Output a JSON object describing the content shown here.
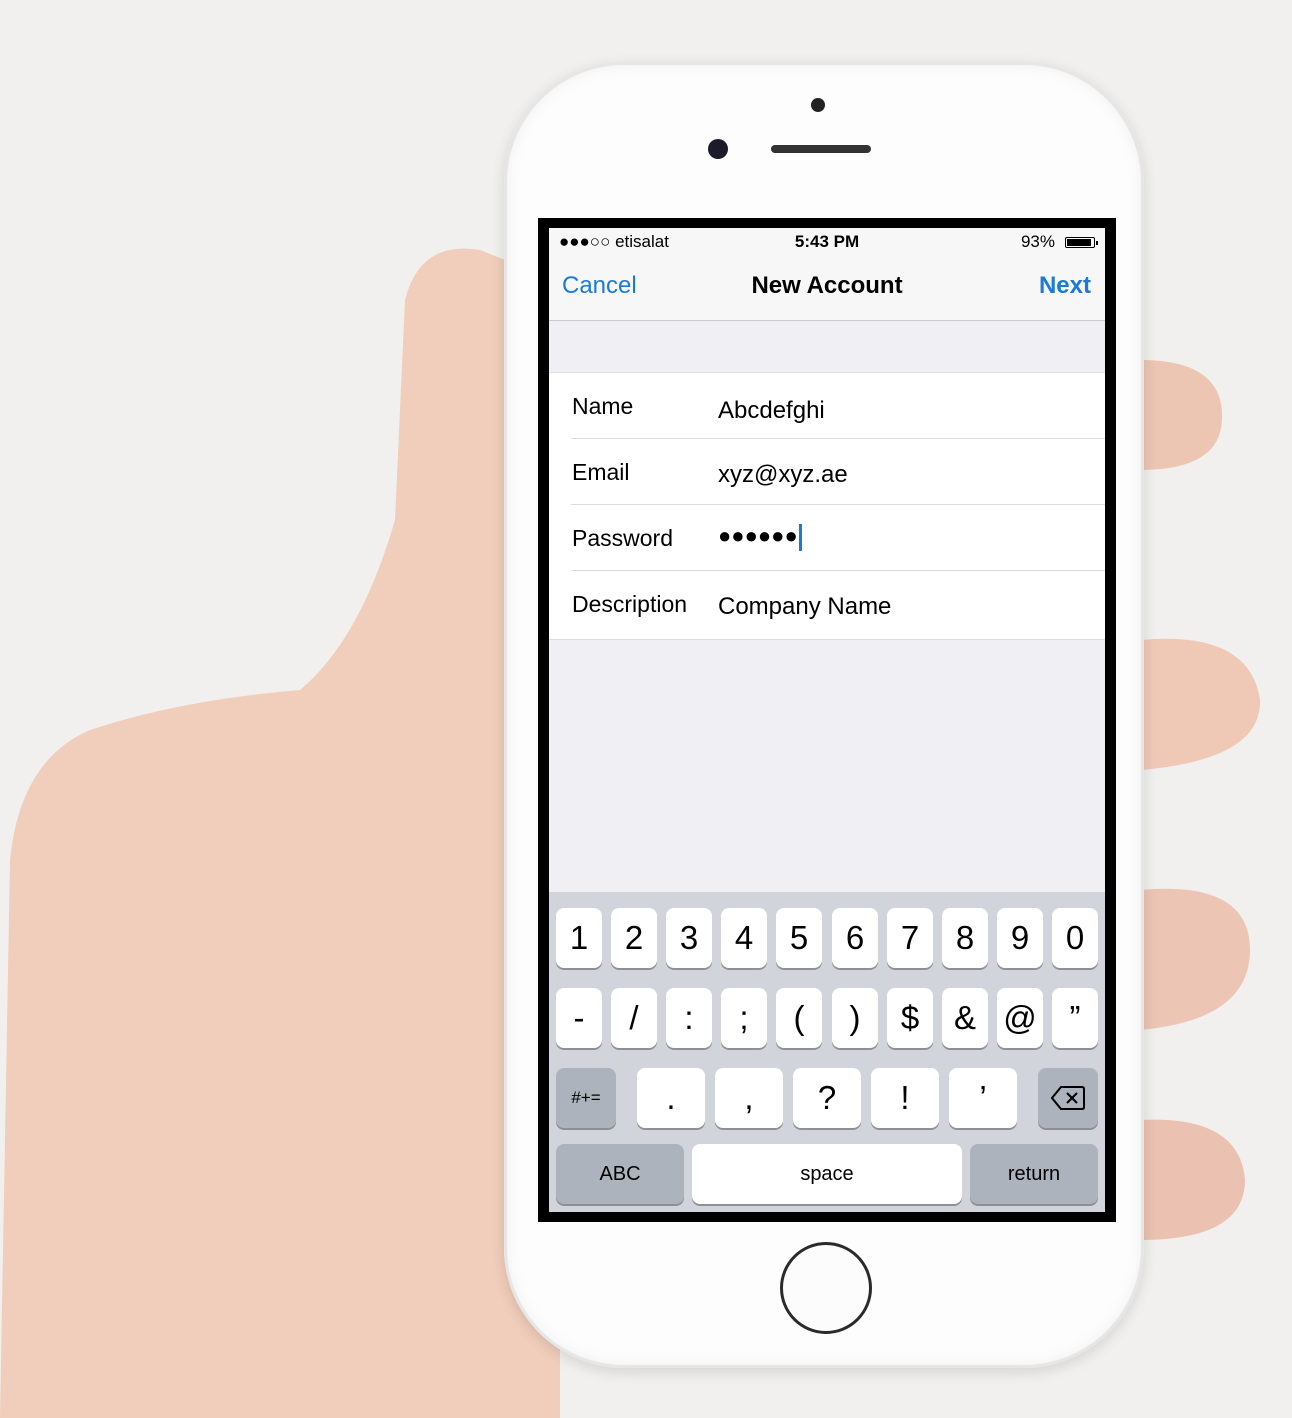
{
  "status": {
    "carrier": "●●●○○ etisalat",
    "time": "5:43 PM",
    "battery": "93%"
  },
  "nav": {
    "cancel": "Cancel",
    "title": "New Account",
    "next": "Next"
  },
  "form": {
    "name_label": "Name",
    "name_value": "Abcdefghi",
    "email_label": "Email",
    "email_value": "xyz@xyz.ae",
    "password_label": "Password",
    "password_value": "●●●●●●",
    "description_label": "Description",
    "description_value": "Company Name"
  },
  "keyboard": {
    "row1": [
      "1",
      "2",
      "3",
      "4",
      "5",
      "6",
      "7",
      "8",
      "9",
      "0"
    ],
    "row2": [
      "-",
      "/",
      ":",
      ";",
      "(",
      ")",
      "$",
      "&",
      "@",
      "”"
    ],
    "row3": [
      ".",
      ",",
      "?",
      "!",
      "’"
    ],
    "symbols": "#+=",
    "abc": "ABC",
    "space": "space",
    "return": "return"
  },
  "colors": {
    "accent": "#1a7ad6",
    "keyboard_bg": "#d1d5db",
    "dark_key": "#acb3bd"
  }
}
